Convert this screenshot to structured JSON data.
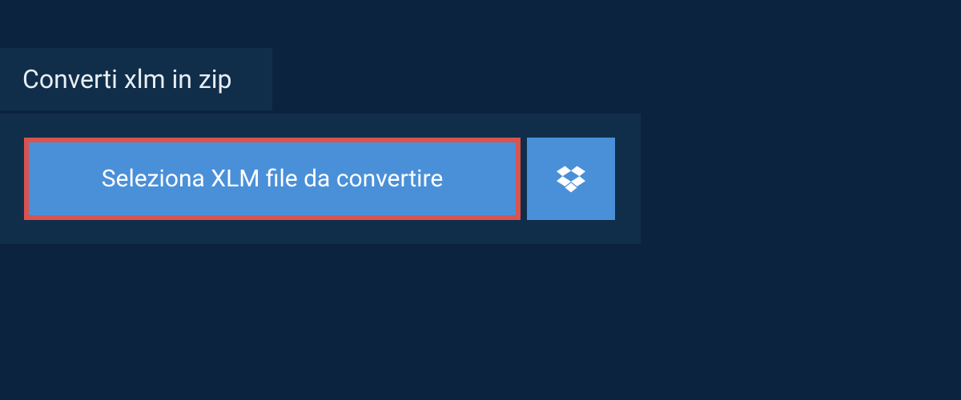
{
  "tab": {
    "label": "Converti xlm in zip"
  },
  "panel": {
    "select_file_label": "Seleziona XLM file da convertire",
    "dropbox_icon": "dropbox-icon"
  }
}
